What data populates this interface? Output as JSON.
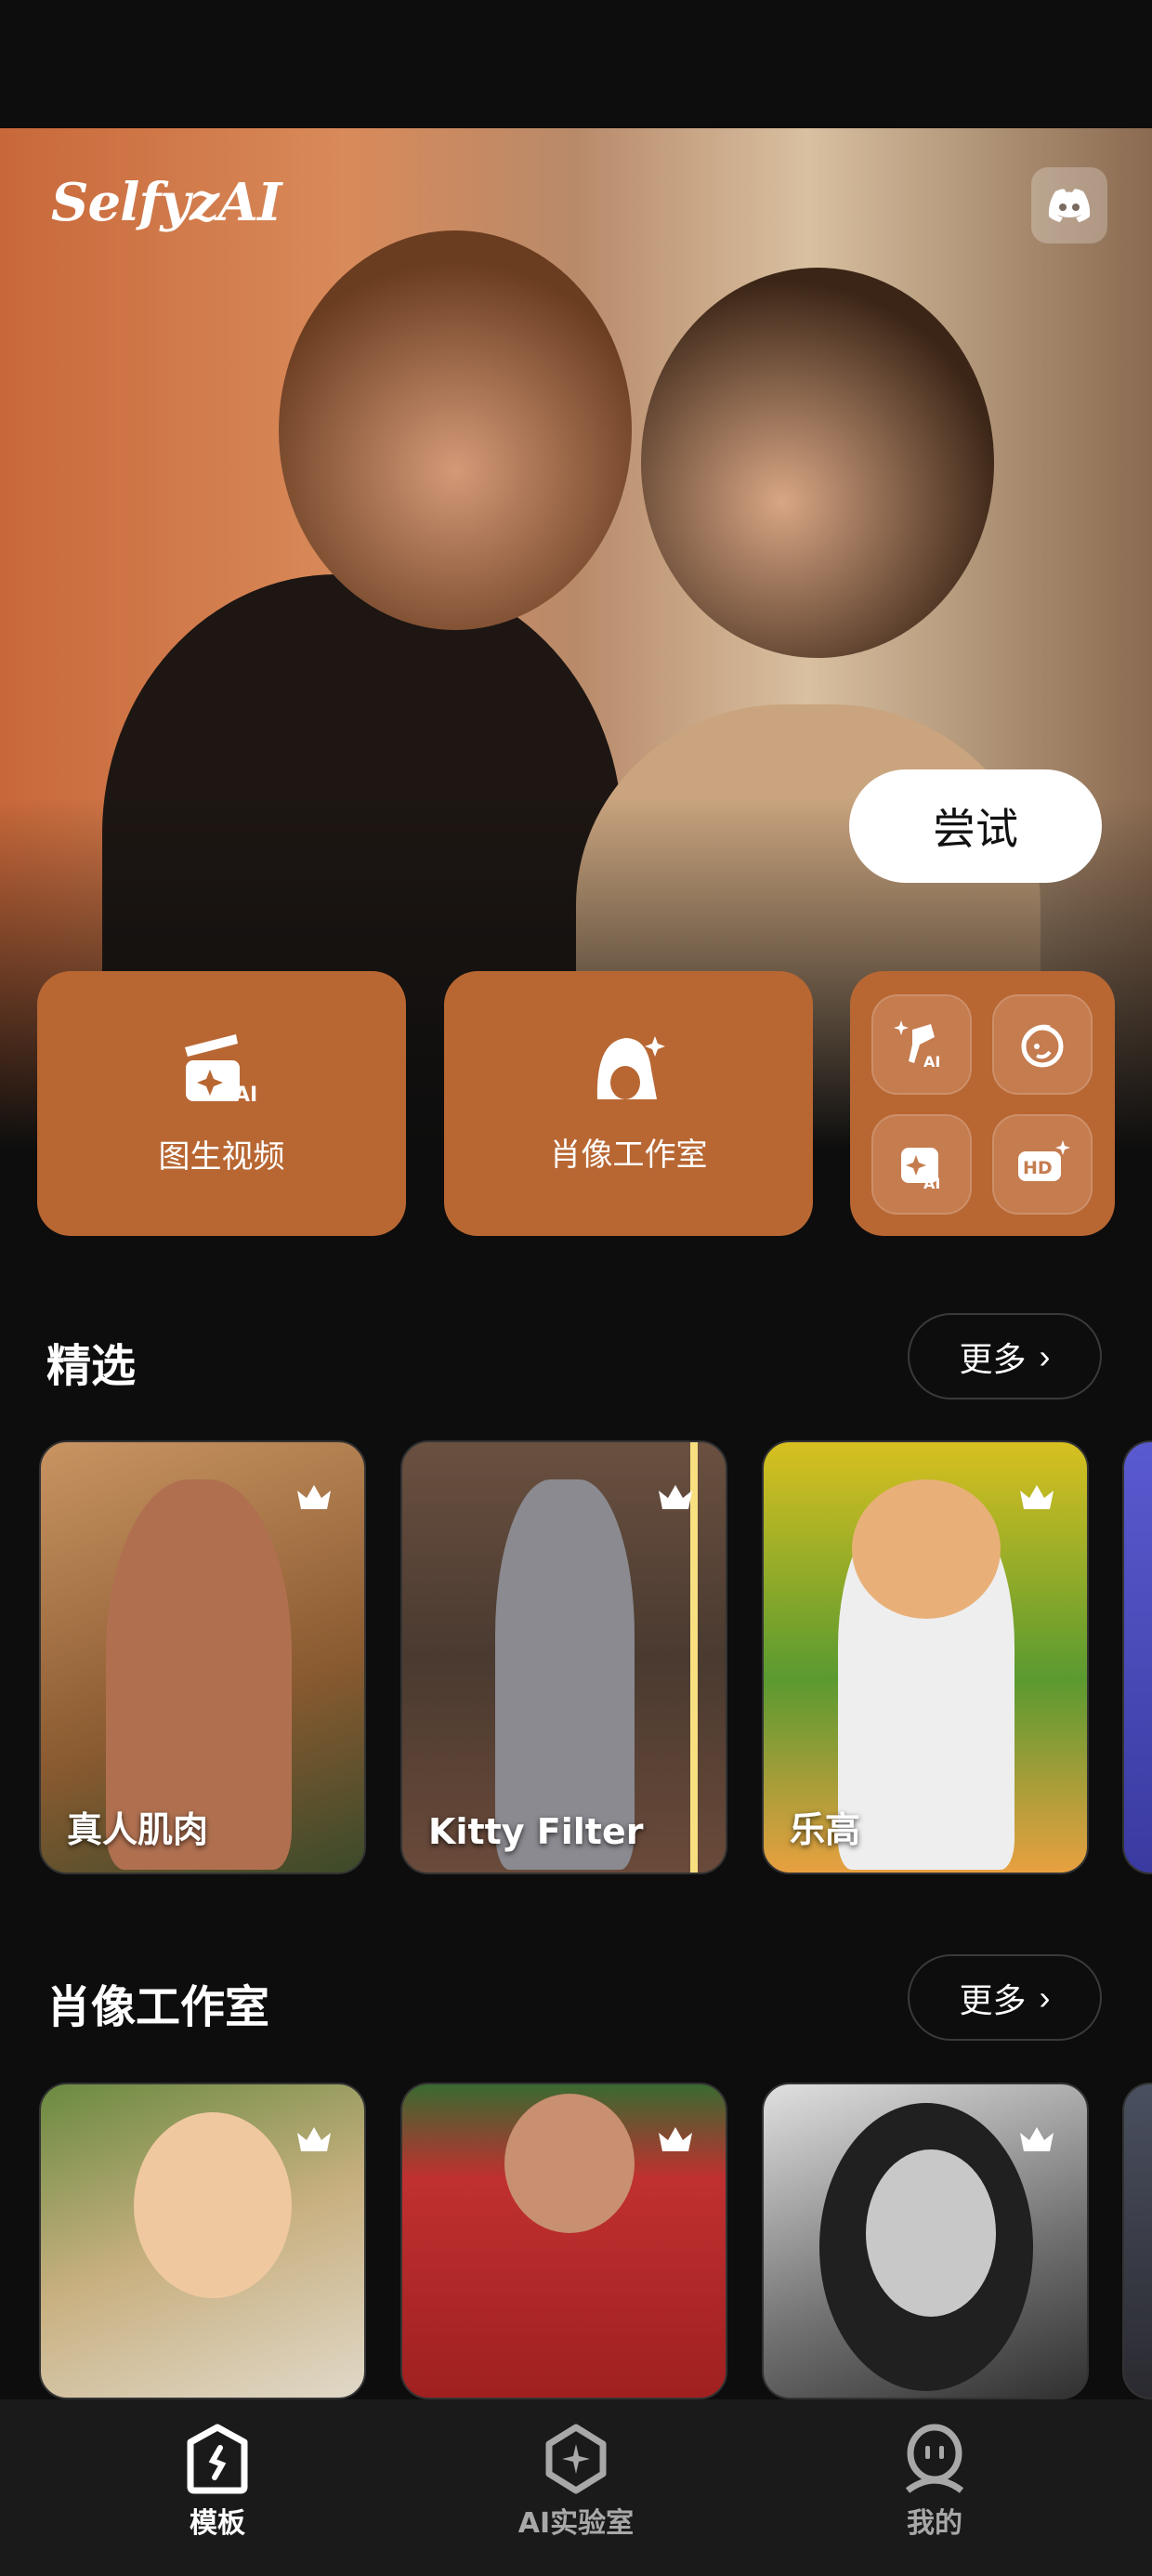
{
  "brand": {
    "logo": "SelfyzAI",
    "discord_icon": "discord-icon"
  },
  "hero": {
    "try_label": "尝试"
  },
  "features": [
    {
      "label": "图生视频",
      "icon": "image-to-video-ai-icon"
    },
    {
      "label": "肖像工作室",
      "icon": "portrait-studio-icon"
    }
  ],
  "tools": [
    {
      "icon": "ai-brush-icon"
    },
    {
      "icon": "face-swap-icon"
    },
    {
      "icon": "ai-image-icon"
    },
    {
      "icon": "hd-enhance-icon"
    }
  ],
  "sections": [
    {
      "title": "精选",
      "more": "更多",
      "items": [
        {
          "label": "真人肌肉"
        },
        {
          "label": "Kitty Filter"
        },
        {
          "label": "乐高"
        },
        {
          "label": ""
        }
      ]
    },
    {
      "title": "肖像工作室",
      "more": "更多",
      "items": [
        {
          "label": ""
        },
        {
          "label": ""
        },
        {
          "label": ""
        },
        {
          "label": ""
        }
      ]
    }
  ],
  "colors": {
    "accent": "#b86733",
    "background": "#0d0d0d",
    "nav": "#1a1a1a"
  },
  "nav": [
    {
      "label": "模板",
      "active": true,
      "icon": "template-icon"
    },
    {
      "label": "AI实验室",
      "active": false,
      "icon": "ai-lab-icon"
    },
    {
      "label": "我的",
      "active": false,
      "icon": "profile-icon"
    }
  ]
}
